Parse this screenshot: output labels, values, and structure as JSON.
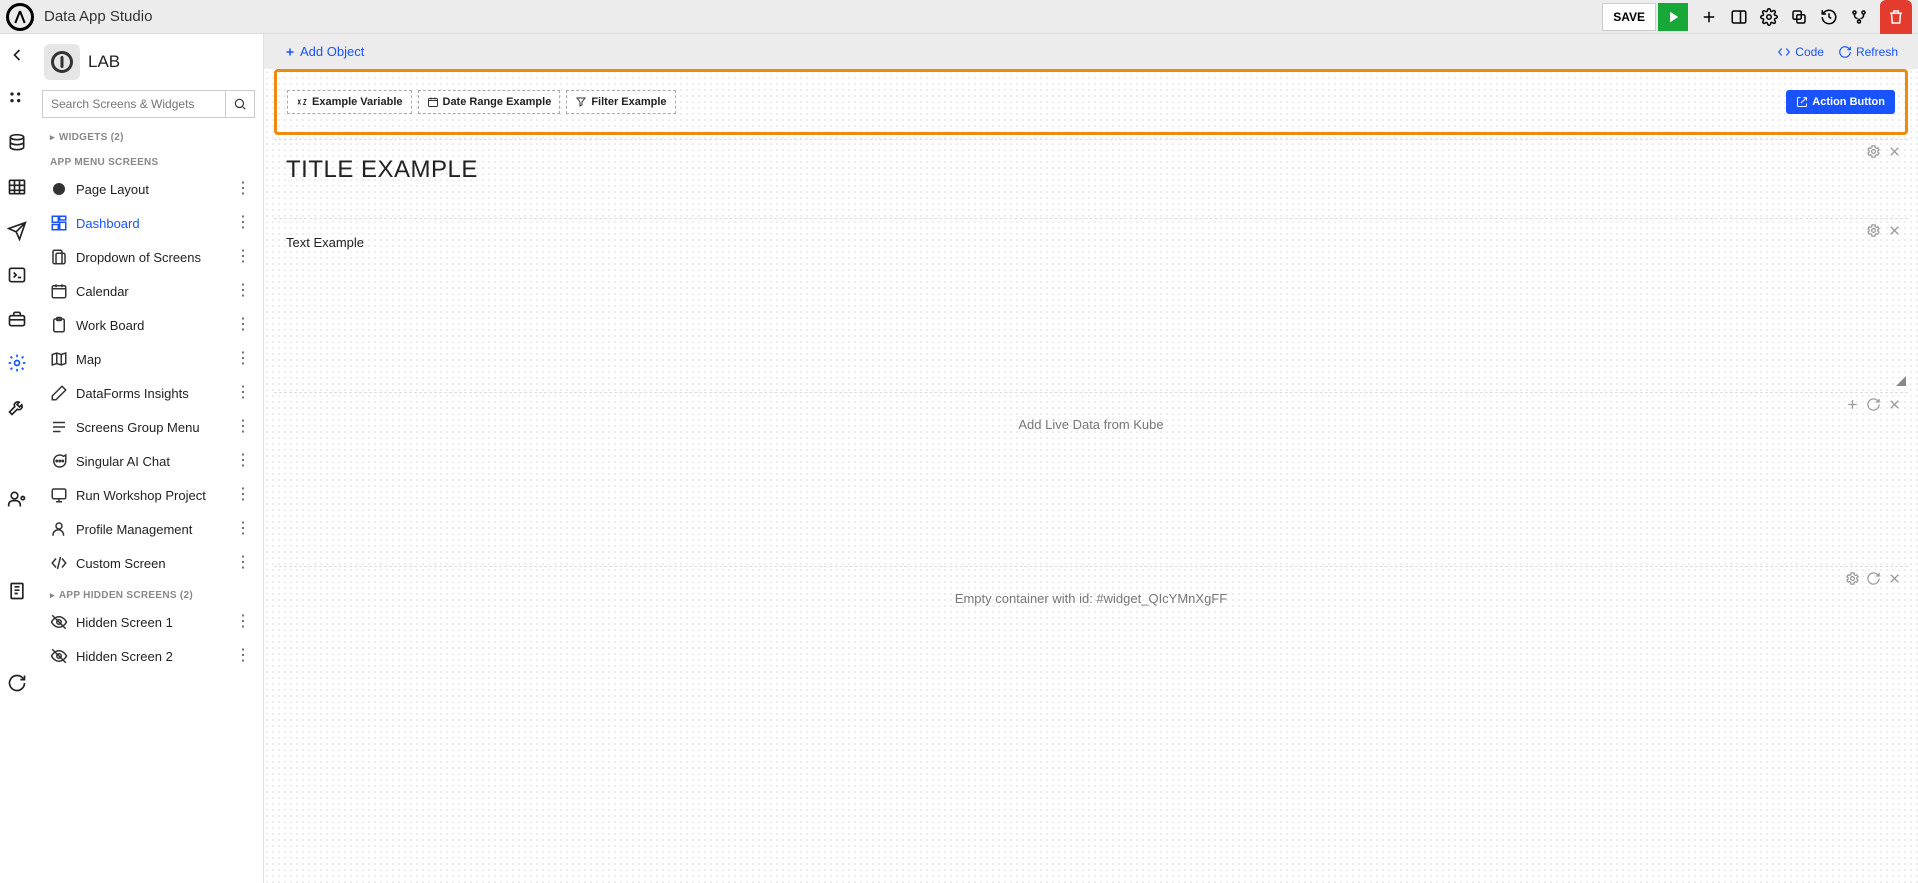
{
  "header": {
    "app_title": "Data App Studio",
    "save_label": "SAVE"
  },
  "sidebar": {
    "app_name": "LAB",
    "search_placeholder": "Search Screens & Widgets",
    "widgets_label": "WIDGETS (2)",
    "section_menu_label": "APP MENU SCREENS",
    "section_hidden_label": "APP HIDDEN SCREENS (2)",
    "items": [
      {
        "label": "Page Layout"
      },
      {
        "label": "Dashboard"
      },
      {
        "label": "Dropdown of Screens"
      },
      {
        "label": "Calendar"
      },
      {
        "label": "Work Board"
      },
      {
        "label": "Map"
      },
      {
        "label": "DataForms Insights"
      },
      {
        "label": "Screens Group Menu"
      },
      {
        "label": "Singular AI Chat"
      },
      {
        "label": "Run Workshop Project"
      },
      {
        "label": "Profile Management"
      },
      {
        "label": "Custom Screen"
      }
    ],
    "hidden_items": [
      {
        "label": "Hidden Screen 1"
      },
      {
        "label": "Hidden Screen 2"
      }
    ]
  },
  "canvas": {
    "add_object_label": "Add Object",
    "code_label": "Code",
    "refresh_label": "Refresh",
    "toolbar": {
      "variable_label": "Example Variable",
      "daterange_label": "Date Range Example",
      "filter_label": "Filter Example",
      "action_label": "Action Button"
    },
    "title_block": "TITLE EXAMPLE",
    "text_block": "Text Example",
    "live_data_text": "Add Live Data from Kube",
    "empty_container_text": "Empty container with id: #widget_QIcYMnXgFF"
  }
}
